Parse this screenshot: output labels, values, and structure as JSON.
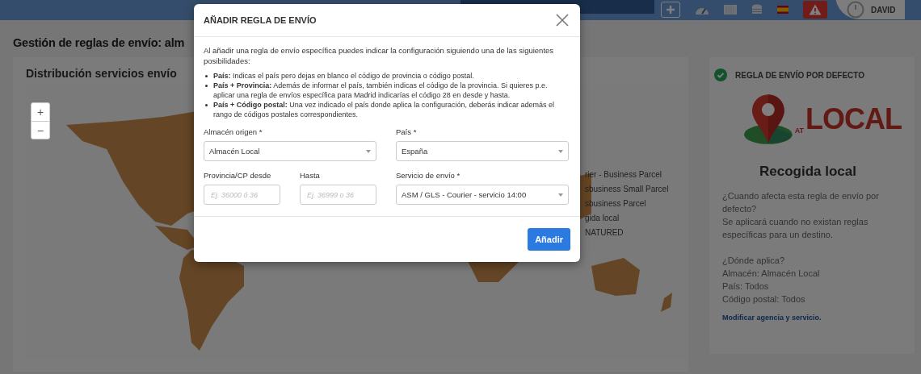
{
  "top_bar": {
    "user": {
      "name": "DAVID"
    }
  },
  "page": {
    "title": "Gestión de reglas de envío: alm"
  },
  "map_card": {
    "title": "Distribución servicios envío",
    "zoom_buttons": [
      "+",
      "−"
    ],
    "legend": [
      "rier - Business Parcel",
      "sbusiness Small Parcel",
      "sbusiness Parcel",
      "gida local",
      "NATURED"
    ]
  },
  "default_rule": {
    "heading": "REGLA DE ENVÍO POR DEFECTO",
    "logo": {
      "small": "AT",
      "large": "LOCAL"
    },
    "service": "Recogida local",
    "blocks": [
      [
        "¿Cuando afecta esta regla de envío por defecto?",
        "Se aplicará cuando no existan reglas específicas para un destino."
      ],
      [
        "¿Dónde aplica?",
        "Almacén: Almacén Local",
        "País: Todos",
        "Código postal: Todos"
      ]
    ],
    "link": "Modificar agencia y servicio."
  },
  "dialog": {
    "title": "AÑADIR REGLA DE ENVÍO",
    "intro": "Al añadir una regla de envío específica puedes indicar la configuración siguiendo una de las siguientes posibilidades:",
    "bullets": [
      "**País:** Indicas el país pero dejas en blanco el código de provincia o código postal.",
      "**País + Provincia:** Además de informar el país, también indicas el código de la provincia. Si quieres p.e. aplicar una regla de envíos específica para Madrid indicarías el código 28 en desde y hasta.",
      "**País + Código postal:** Una vez indicado el país donde aplica la configuración, deberás indicar además el rango de códigos postales correspondientes."
    ],
    "fields": [
      {
        "kind": "select",
        "label": "Almacén origen *",
        "value": "Almacén Local"
      },
      {
        "kind": "select",
        "label": "País *",
        "value": "España"
      },
      {
        "kind": "text",
        "label": "Provincia/CP desde",
        "placeholder": "Ej. 36000 ó 36"
      },
      {
        "kind": "text",
        "label": "Hasta",
        "placeholder": "Ej. 36999 o 36"
      },
      {
        "kind": "select",
        "label": "Servicio de envío *",
        "value": "ASM / GLS - Courier - servicio 14:00"
      }
    ],
    "button": "Añadir"
  }
}
